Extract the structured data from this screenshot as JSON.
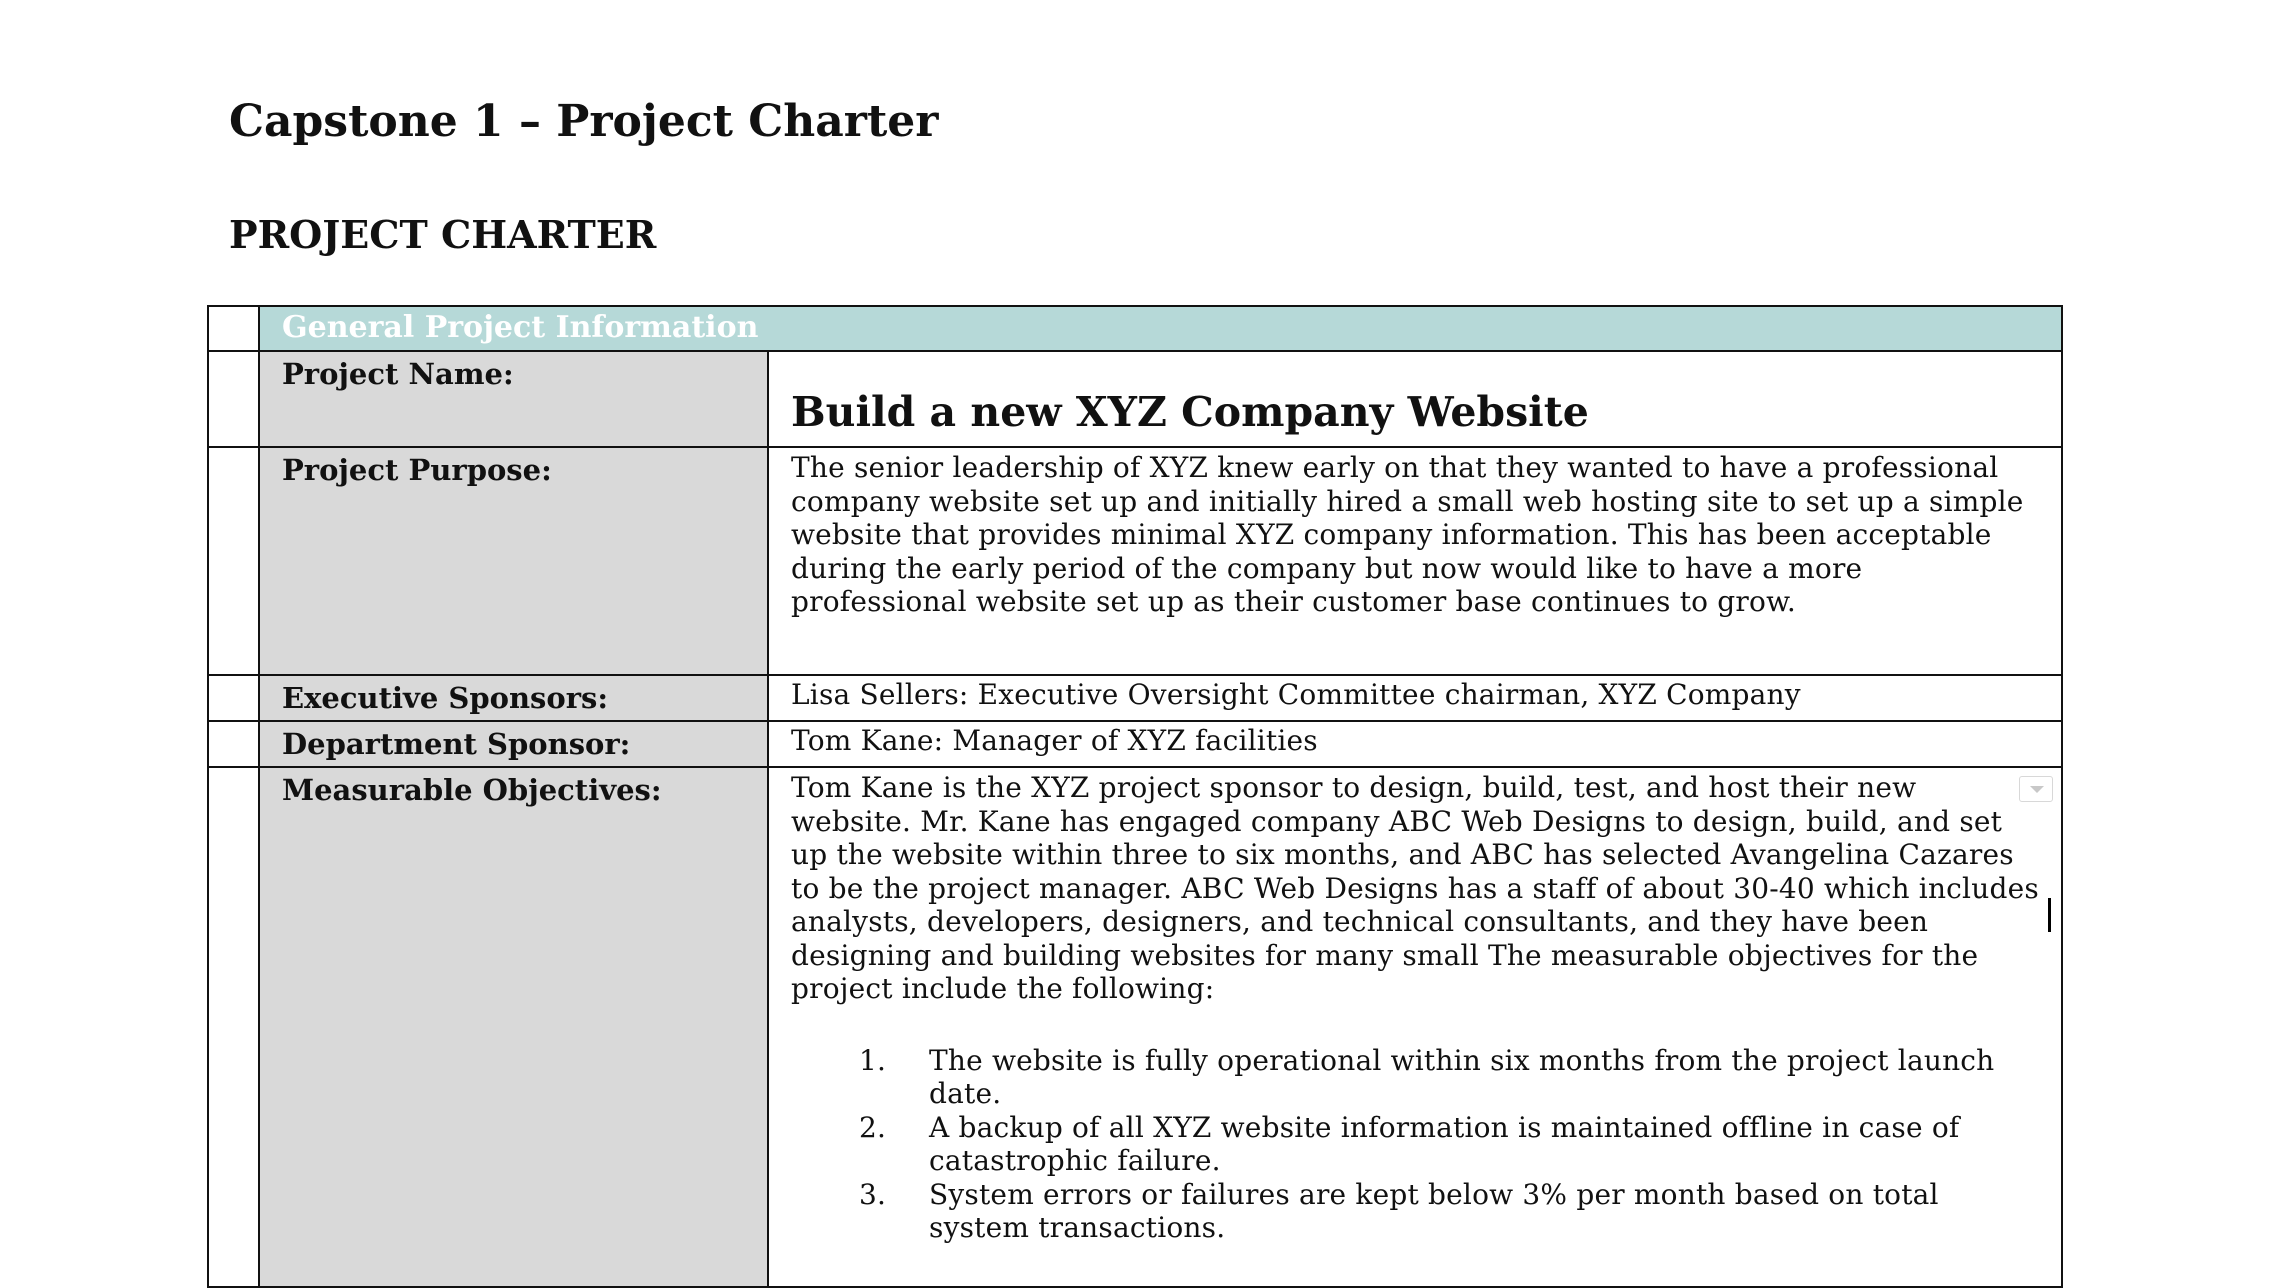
{
  "document": {
    "title": "Capstone 1 – Project Charter",
    "section_heading": "PROJECT CHARTER"
  },
  "table": {
    "header": "General Project Information",
    "project_name": {
      "label": "Project Name:",
      "value": "Build a new XYZ Company Website"
    },
    "project_purpose": {
      "label": "Project Purpose:",
      "value": "The senior leadership of XYZ knew early on that they wanted to have a professional company website set up and initially hired a small web hosting site to set up a simple website that provides minimal XYZ company information. This has been acceptable during the early period of the company but now would like to have a more professional website set up as their customer base continues to grow."
    },
    "executive_sponsors": {
      "label": "Executive Sponsors:",
      "value": "Lisa Sellers: Executive Oversight Committee chairman, XYZ Company"
    },
    "department_sponsor": {
      "label": "Department Sponsor:",
      "value": "Tom Kane: Manager of XYZ facilities"
    },
    "measurable_objectives": {
      "label": "Measurable Objectives:",
      "intro": "Tom Kane is the XYZ project sponsor to design, build, test, and host their new website. Mr. Kane has engaged company ABC Web Designs to design, build, and set up the website within three to six months, and ABC has selected Avangelina Cazares  to be the project manager. ABC Web Designs has a staff of about 30-40 which includes analysts, developers, designers, and technical consultants, and they have been designing and building websites for many small The measurable objectives for the project include the following:",
      "items": [
        {
          "number": "1.",
          "text": "The website is fully operational within six months from the project launch date."
        },
        {
          "number": "2.",
          "text": "A backup of all XYZ website information is maintained offline in case of catastrophic failure."
        },
        {
          "number": "3.",
          "text": "System errors or failures are kept below 3% per month based on total system transactions."
        }
      ]
    }
  },
  "colors": {
    "header_background": "#b6d9d8",
    "label_background": "#d9d9d9",
    "border": "#111111",
    "header_text": "#ffffff"
  },
  "icons": {
    "dropdown": "chevron-down-icon",
    "cursor": "text-cursor"
  }
}
